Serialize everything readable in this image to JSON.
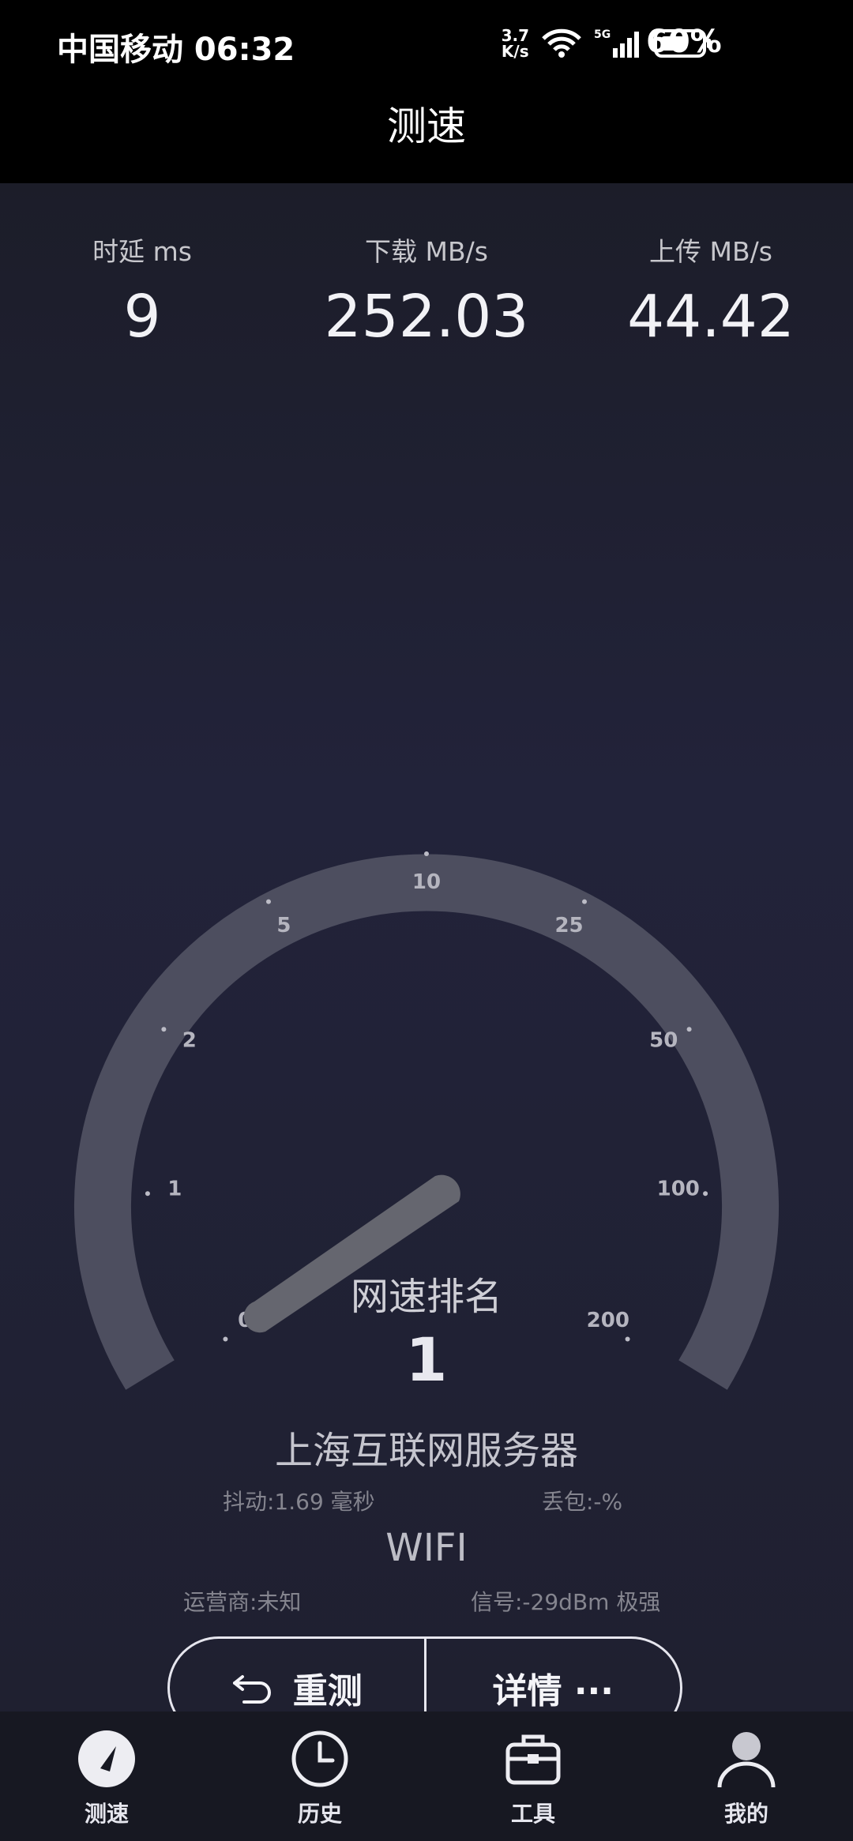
{
  "status": {
    "carrier_time": "中国移动 06:32",
    "net_speed_value": "3.7",
    "net_speed_unit": "K/s",
    "battery": "60%"
  },
  "header": {
    "title": "测速"
  },
  "metrics": {
    "latency_label": "时延 ms",
    "latency_value": "9",
    "download_label": "下载 MB/s",
    "download_value": "252.03",
    "upload_label": "上传 MB/s",
    "upload_value": "44.42"
  },
  "gauge": {
    "ticks": [
      "0",
      "1",
      "2",
      "5",
      "10",
      "25",
      "50",
      "100",
      "200"
    ],
    "needle_value": "0"
  },
  "result": {
    "rank_label": "网速排名",
    "rank_value": "1",
    "server": "上海互联网服务器",
    "jitter": "抖动:1.69 毫秒",
    "packet_loss": "丢包:-%",
    "connection": "WIFI",
    "carrier": "运营商:未知",
    "signal": "信号:-29dBm 极强"
  },
  "actions": {
    "retest": "重测",
    "details": "详情 ···"
  },
  "tabs": [
    {
      "label": "测速",
      "icon": "speedometer-icon"
    },
    {
      "label": "历史",
      "icon": "clock-icon"
    },
    {
      "label": "工具",
      "icon": "toolbox-icon"
    },
    {
      "label": "我的",
      "icon": "user-icon"
    }
  ]
}
